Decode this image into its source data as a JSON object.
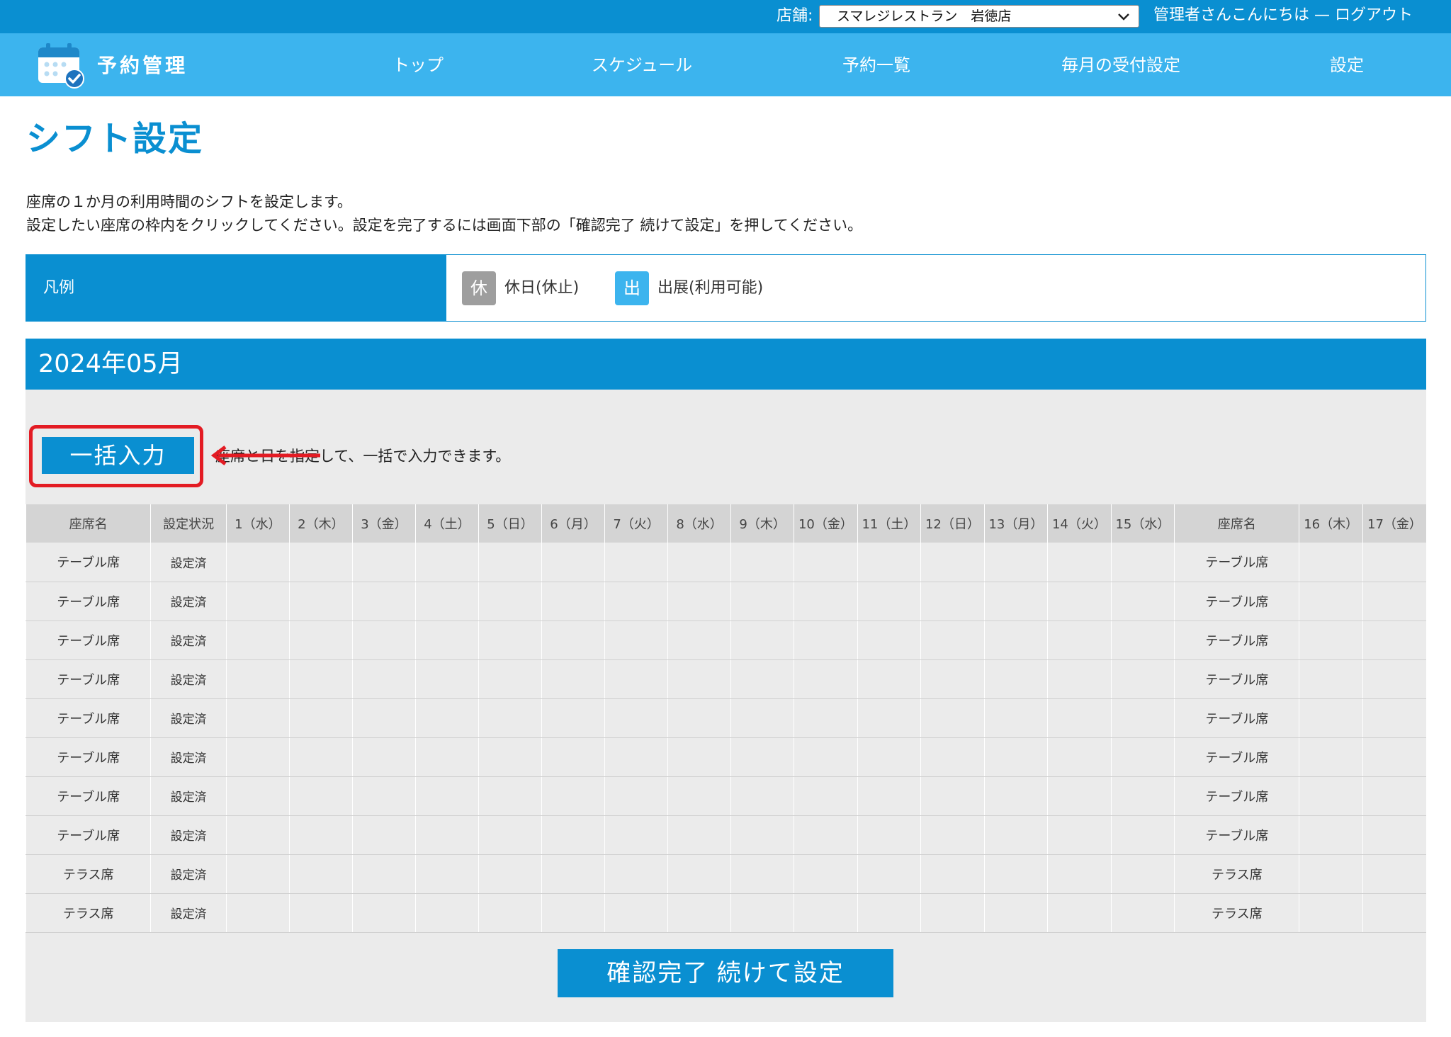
{
  "topbar": {
    "store_label": "店舗:",
    "store_selected": "スマレジレストラン　岩徳店",
    "greeting": "管理者さんこんにちは",
    "separator": " — ",
    "logout": "ログアウト"
  },
  "nav": {
    "logo_text": "予約管理",
    "items": [
      {
        "label": "トップ"
      },
      {
        "label": "スケジュール"
      },
      {
        "label": "予約一覧"
      },
      {
        "label": "毎月の受付設定"
      },
      {
        "label": "設定"
      }
    ]
  },
  "page": {
    "title": "シフト設定",
    "desc_line1": "座席の１か月の利用時間のシフトを設定します。",
    "desc_line2": "設定したい座席の枠内をクリックしてください。設定を完了するには画面下部の「確認完了 続けて設定」を押してください。"
  },
  "legend": {
    "title": "凡例",
    "items": [
      {
        "badge": "休",
        "label": "休日(休止)",
        "color": "#9e9e9e"
      },
      {
        "badge": "出",
        "label": "出展(利用可能)",
        "color": "#3cb4ee"
      }
    ]
  },
  "month": {
    "label": "2024年05月"
  },
  "bulk": {
    "button_label": "一括入力",
    "note": "座席と日を指定して、一括で入力できます。"
  },
  "table": {
    "seat_header": "座席名",
    "status_header": "設定状況",
    "days_first": [
      "1（水）",
      "2（木）",
      "3（金）",
      "4（土）",
      "5（日）",
      "6（月）",
      "7（火）",
      "8（水）",
      "9（木）",
      "10（金）",
      "11（土）",
      "12（日）",
      "13（月）",
      "14（火）",
      "15（水）"
    ],
    "days_second": [
      "16（木）",
      "17（金）"
    ],
    "rows": [
      {
        "seat": "テーブル席",
        "status": "設定済"
      },
      {
        "seat": "テーブル席",
        "status": "設定済"
      },
      {
        "seat": "テーブル席",
        "status": "設定済"
      },
      {
        "seat": "テーブル席",
        "status": "設定済"
      },
      {
        "seat": "テーブル席",
        "status": "設定済"
      },
      {
        "seat": "テーブル席",
        "status": "設定済"
      },
      {
        "seat": "テーブル席",
        "status": "設定済"
      },
      {
        "seat": "テーブル席",
        "status": "設定済"
      },
      {
        "seat": "テラス席",
        "status": "設定済"
      },
      {
        "seat": "テラス席",
        "status": "設定済"
      }
    ]
  },
  "confirm": {
    "button_label": "確認完了 続けて設定"
  }
}
